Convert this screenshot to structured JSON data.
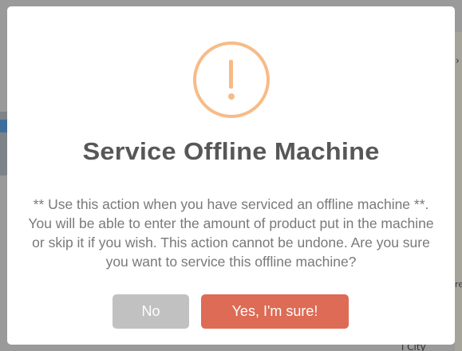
{
  "dialog": {
    "icon": "warning-exclamation-icon",
    "icon_color": "#f8bb86",
    "title": "Service Offline Machine",
    "message": "** Use this action when you have serviced an offline machine **. You will be able to enter the amount of product put in the machine or skip it if you wish. This action cannot be undone. Are you sure you want to service this offline machine?",
    "cancel_label": "No",
    "confirm_label": "Yes, I'm sure!",
    "cancel_color": "#c1c1c1",
    "confirm_color": "#dd6b55"
  },
  "background": {
    "map_label_fragment": "i City",
    "right_chevron": "›",
    "right_text_fragment": "re"
  }
}
